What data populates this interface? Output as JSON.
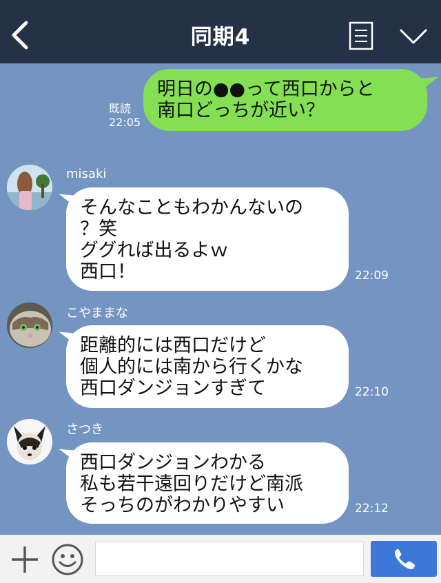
{
  "header": {
    "title": "同期4",
    "bg_color": "#243147"
  },
  "messages": [
    {
      "direction": "outgoing",
      "text": "明日の●●って西口からと\n南口どっちが近い？",
      "read_label": "既読",
      "time": "22:05"
    },
    {
      "direction": "incoming",
      "sender": "misaki",
      "text": "そんなこともわかんないの\n？笑\nググれば出るよｗ\n西口！",
      "time": "22:09"
    },
    {
      "direction": "incoming",
      "sender": "こやままな",
      "text": "距離的には西口だけど\n個人的には南から行くかな\n西口ダンジョンすぎて",
      "time": "22:10"
    },
    {
      "direction": "incoming",
      "sender": "さつき",
      "text": "西口ダンジョンわかる\n私も若干遠回りだけど南派\nそっちのがわかりやすい",
      "time": "22:12"
    }
  ],
  "input": {
    "placeholder": ""
  },
  "colors": {
    "chat_bg": "#7494c2",
    "outgoing_bubble": "#84e052",
    "incoming_bubble": "#ffffff",
    "call_button": "#3d78d8"
  },
  "icons": {
    "back": "chevron-left-icon",
    "notes": "notes-icon",
    "menu": "chevron-down-icon",
    "add": "plus-icon",
    "emoji": "smiley-icon",
    "call": "phone-icon"
  }
}
